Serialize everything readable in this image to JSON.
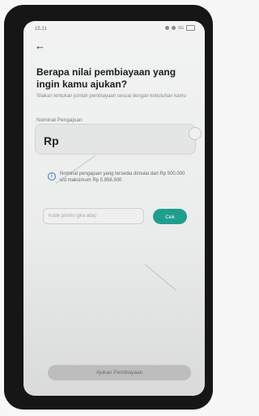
{
  "status_bar": {
    "time": "15.21",
    "network": "5G",
    "icons": [
      "signal-icon",
      "wifi-icon",
      "battery-icon"
    ]
  },
  "header": {
    "back_icon": "back-arrow-icon",
    "title": "Berapa nilai pembiayaan yang ingin kamu ajukan?",
    "subtitle": "Silakan tentukan jumlah pembiayaan sesuai dengan kebutuhan kamu"
  },
  "amount_field": {
    "label": "Nominal Pengajuan",
    "currency": "Rp",
    "value": ""
  },
  "info": {
    "icon": "info-icon",
    "text": "Nominal pengajuan yang tersedia dimulai dari Rp 500.000 s/d maksimum Rp 5.956.500"
  },
  "promo": {
    "placeholder": "Kode promo (jika ada)",
    "value": "",
    "check_label": "Cek"
  },
  "footer": {
    "submit_label": "Ajukan Pembiayaan"
  },
  "colors": {
    "accent": "#1f9e8e",
    "info": "#3a78c4",
    "disabled_button": "#bdbdbd"
  }
}
